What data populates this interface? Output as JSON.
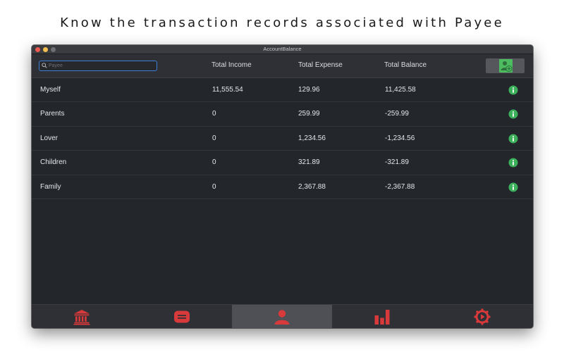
{
  "headline": "Know the transaction records associated with Payee",
  "window": {
    "title": "AccountBalance"
  },
  "search": {
    "placeholder": "Payee",
    "value": ""
  },
  "columns": {
    "income": "Total Income",
    "expense": "Total Expense",
    "balance": "Total Balance"
  },
  "rows": [
    {
      "payee": "Myself",
      "income": "11,555.54",
      "expense": "129.96",
      "balance": "11,425.58"
    },
    {
      "payee": "Parents",
      "income": "0",
      "expense": "259.99",
      "balance": "-259.99"
    },
    {
      "payee": "Lover",
      "income": "0",
      "expense": "1,234.56",
      "balance": "-1,234.56"
    },
    {
      "payee": "Children",
      "income": "0",
      "expense": "321.89",
      "balance": "-321.89"
    },
    {
      "payee": "Family",
      "income": "0",
      "expense": "2,367.88",
      "balance": "-2,367.88"
    }
  ],
  "tabs": [
    {
      "icon": "bank-icon",
      "active": false
    },
    {
      "icon": "transactions-icon",
      "active": false
    },
    {
      "icon": "payee-icon",
      "active": true
    },
    {
      "icon": "chart-icon",
      "active": false
    },
    {
      "icon": "settings-icon",
      "active": false
    }
  ],
  "colors": {
    "accent_red": "#d8393a",
    "info_green": "#3cb05a",
    "add_green": "#4dbb5f",
    "search_focus": "#3f7fd6"
  }
}
